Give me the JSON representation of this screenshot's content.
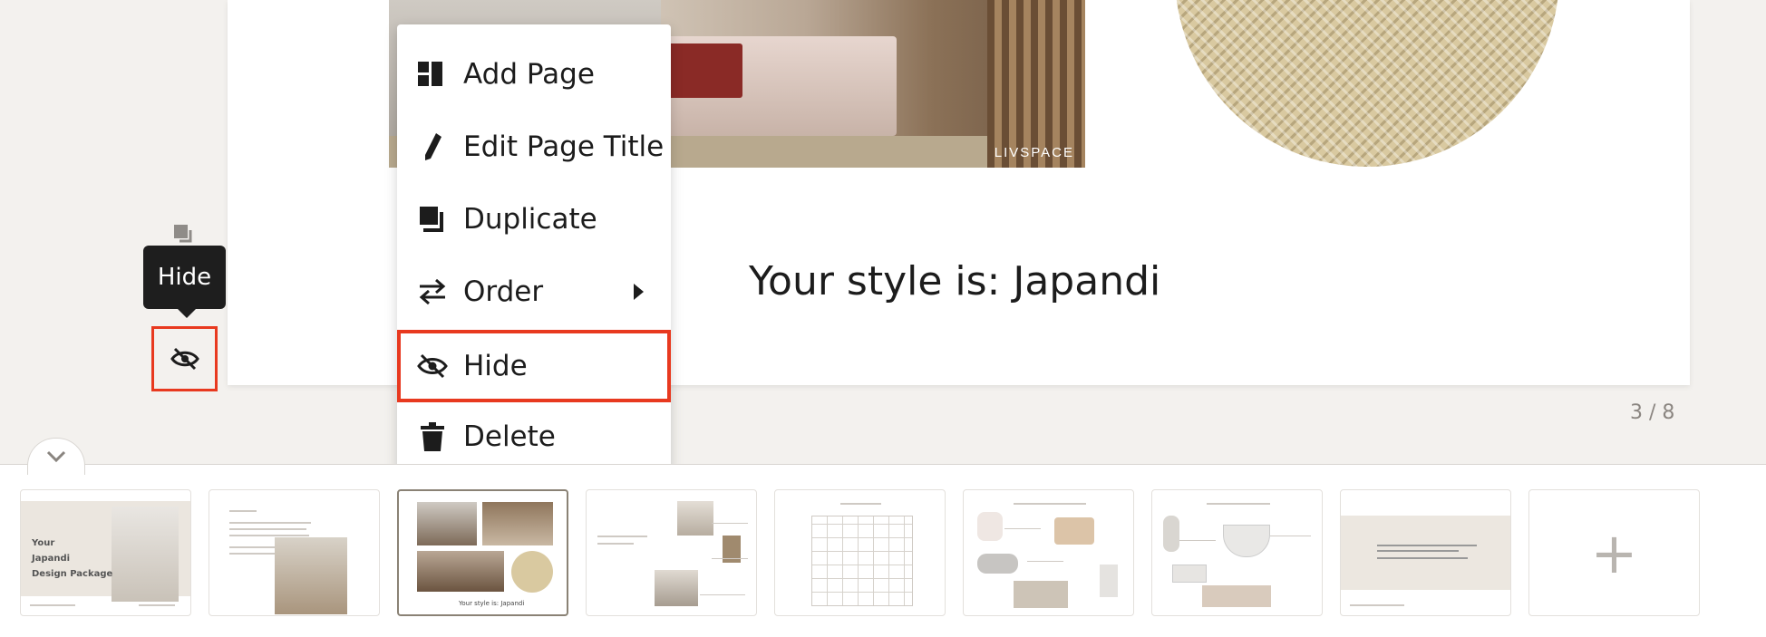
{
  "slide": {
    "caption": "Your style is: Japandi",
    "photo_credit": "LIVSPACE",
    "page_counter": "3 / 8"
  },
  "tooltip": {
    "text": "Hide"
  },
  "context_menu": {
    "items": [
      {
        "label": "Add Page",
        "icon": "add-page-icon"
      },
      {
        "label": "Edit Page Title",
        "icon": "pencil-icon"
      },
      {
        "label": "Duplicate",
        "icon": "duplicate-icon"
      },
      {
        "label": "Order",
        "icon": "order-arrows-icon",
        "has_submenu": true
      },
      {
        "label": "Hide",
        "icon": "eye-slash-icon",
        "highlighted": true
      },
      {
        "label": "Delete",
        "icon": "trash-icon"
      }
    ]
  },
  "filmstrip": {
    "thumbnails": [
      {
        "title": "Your\nJapandi\nDesign Package",
        "active": false
      },
      {
        "title": "",
        "active": false
      },
      {
        "title": "Your style is: Japandi",
        "active": true
      },
      {
        "title": "",
        "active": false
      },
      {
        "title": "",
        "active": false
      },
      {
        "title": "",
        "active": false
      },
      {
        "title": "",
        "active": false
      },
      {
        "title": "",
        "active": false
      }
    ],
    "add_label": "+"
  },
  "colors": {
    "highlight": "#e8391f",
    "tooltip_bg": "#1e1e1e",
    "canvas_bg": "#f3f1ee"
  }
}
